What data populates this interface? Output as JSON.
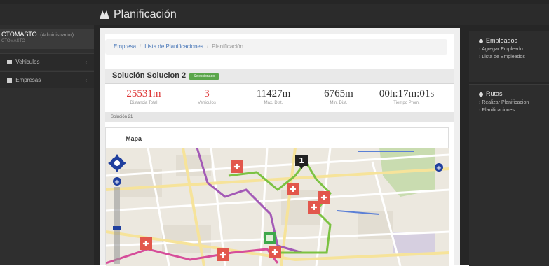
{
  "app": {
    "title": "Planificación"
  },
  "user": {
    "name": "CTOMASTO",
    "role": "(Administrador)",
    "sub": "CTOMASTO"
  },
  "sidebar": {
    "items": [
      {
        "label": "Vehiculos",
        "icon": "car-icon"
      },
      {
        "label": "Empresas",
        "icon": "building-icon"
      }
    ]
  },
  "breadcrumb": [
    "Empresa",
    "Lista de Planificaciones",
    "Planificación"
  ],
  "solution": {
    "title": "Solución Solucion 2",
    "badge": "Seleccionado",
    "stats": [
      {
        "value": "25531m",
        "label": "Distancia Total",
        "highlight": true
      },
      {
        "value": "3",
        "label": "Vehiculos",
        "highlight": true
      },
      {
        "value": "11427m",
        "label": "Max. Dist.",
        "highlight": false
      },
      {
        "value": "6765m",
        "label": "Min. Dist.",
        "highlight": false
      },
      {
        "value": "00h:17m:01s",
        "label": "Tiempo Prom.",
        "highlight": false
      }
    ],
    "sub": "Solución 21"
  },
  "map": {
    "title": "Mapa",
    "marker_number": "1"
  },
  "right": {
    "empleados": {
      "title": "Empleados",
      "links": [
        "Agregar Empleado",
        "Lista de Empleados"
      ]
    },
    "rutas": {
      "title": "Rutas",
      "links": [
        "Realizar Planificacion",
        "Planificaciones"
      ]
    }
  },
  "colors": {
    "route_green": "#7cc242",
    "route_purple": "#a35ab6",
    "route_magenta": "#d64d9a",
    "marker_red": "#e2574c",
    "marker_green": "#3ea84b"
  }
}
